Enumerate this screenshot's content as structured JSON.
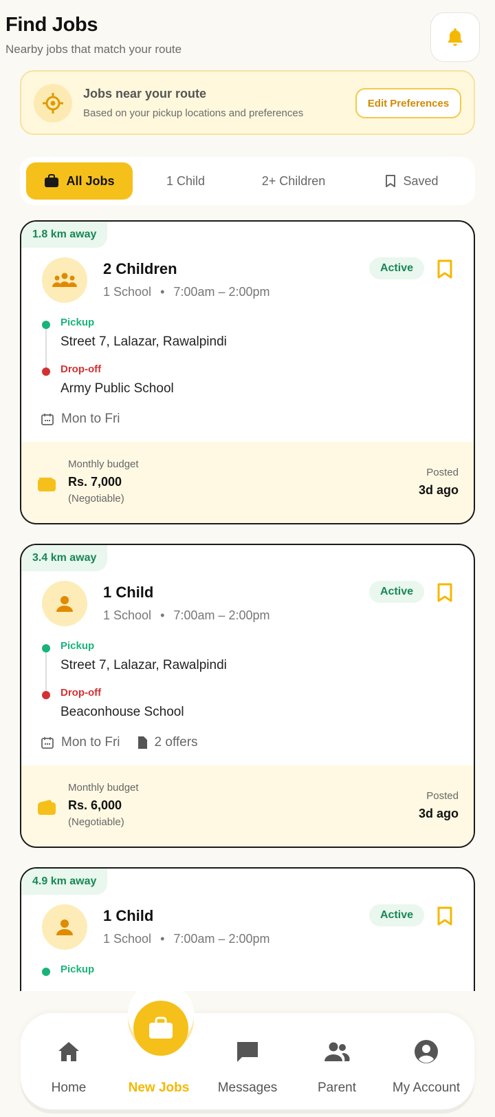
{
  "header": {
    "title": "Find Jobs",
    "subtitle": "Nearby jobs that match your route",
    "bell_icon": "bell-icon"
  },
  "route_banner": {
    "title": "Jobs near your route",
    "subtitle": "Based on your pickup locations and preferences",
    "button": "Edit Preferences"
  },
  "tabs": [
    {
      "label": "All Jobs",
      "active": true
    },
    {
      "label": "1 Child",
      "active": false
    },
    {
      "label": "2+ Children",
      "active": false
    },
    {
      "label": "Saved",
      "active": false
    }
  ],
  "jobs": [
    {
      "distance": "1.8 km away",
      "title": "2 Children",
      "school": "1 School",
      "time": "7:00am – 2:00pm",
      "status": "Active",
      "pickup_label": "Pickup",
      "pickup": "Street 7, Lalazar, Rawalpindi",
      "dropoff_label": "Drop-off",
      "dropoff": "Army Public School",
      "days": "Mon to Fri",
      "offers": "",
      "budget_label": "Monthly budget",
      "budget": "Rs. 7,000",
      "negotiable": "(Negotiable)",
      "posted_label": "Posted",
      "posted": "3d ago"
    },
    {
      "distance": "3.4 km away",
      "title": "1 Child",
      "school": "1 School",
      "time": "7:00am – 2:00pm",
      "status": "Active",
      "pickup_label": "Pickup",
      "pickup": "Street 7, Lalazar, Rawalpindi",
      "dropoff_label": "Drop-off",
      "dropoff": "Beaconhouse School",
      "days": "Mon to Fri",
      "offers": "2 offers",
      "budget_label": "Monthly budget",
      "budget": "Rs. 6,000",
      "negotiable": "(Negotiable)",
      "posted_label": "Posted",
      "posted": "3d ago"
    },
    {
      "distance": "4.9 km away",
      "title": "1 Child",
      "school": "1 School",
      "time": "7:00am – 2:00pm",
      "status": "Active",
      "pickup_label": "Pickup"
    }
  ],
  "nav": [
    {
      "label": "Home",
      "icon": "home-icon",
      "active": false
    },
    {
      "label": "New Jobs",
      "icon": "briefcase-icon",
      "active": true
    },
    {
      "label": "Messages",
      "icon": "message-icon",
      "active": false
    },
    {
      "label": "Parent",
      "icon": "people-icon",
      "active": false
    },
    {
      "label": "My Account",
      "icon": "account-icon",
      "active": false
    }
  ],
  "colors": {
    "accent": "#f5c01a",
    "success": "#198754",
    "danger": "#d33131",
    "background": "#faf9f4"
  }
}
